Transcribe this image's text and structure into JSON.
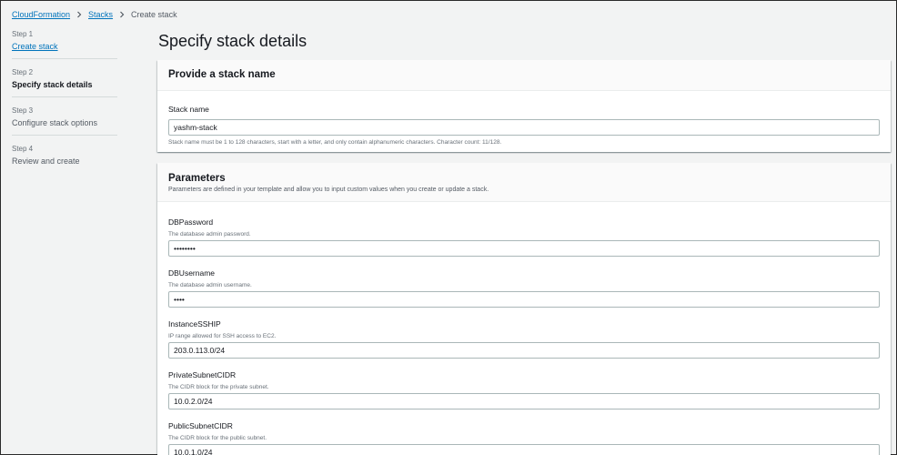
{
  "breadcrumb": {
    "items": [
      {
        "label": "CloudFormation"
      },
      {
        "label": "Stacks"
      }
    ],
    "current": "Create stack"
  },
  "wizard": {
    "steps": [
      {
        "num": "Step 1",
        "label": "Create stack",
        "state": "link"
      },
      {
        "num": "Step 2",
        "label": "Specify stack details",
        "state": "active"
      },
      {
        "num": "Step 3",
        "label": "Configure stack options",
        "state": "inactive"
      },
      {
        "num": "Step 4",
        "label": "Review and create",
        "state": "inactive"
      }
    ]
  },
  "page": {
    "title": "Specify stack details"
  },
  "stack_name_panel": {
    "title": "Provide a stack name",
    "field_label": "Stack name",
    "value": "yashm-stack",
    "constraint": "Stack name must be 1 to 128 characters, start with a letter, and only contain alphanumeric characters. Character count: 11/128."
  },
  "parameters_panel": {
    "title": "Parameters",
    "description": "Parameters are defined in your template and allow you to input custom values when you create or update a stack.",
    "fields": [
      {
        "label": "DBPassword",
        "description": "The database admin password.",
        "value": "••••••••"
      },
      {
        "label": "DBUsername",
        "description": "The database admin username.",
        "value": "••••"
      },
      {
        "label": "InstanceSSHIP",
        "description": "IP range allowed for SSH access to EC2.",
        "value": "203.0.113.0/24"
      },
      {
        "label": "PrivateSubnetCIDR",
        "description": "The CIDR block for the private subnet.",
        "value": "10.0.2.0/24"
      },
      {
        "label": "PublicSubnetCIDR",
        "description": "The CIDR block for the public subnet.",
        "value": "10.0.1.0/24"
      }
    ]
  },
  "colors": {
    "link": "#0073bb",
    "background": "#f2f3f3",
    "panel": "#ffffff",
    "border": "#aab7b8"
  },
  "icons": {
    "breadcrumb_separator": "chevron-right-icon"
  }
}
